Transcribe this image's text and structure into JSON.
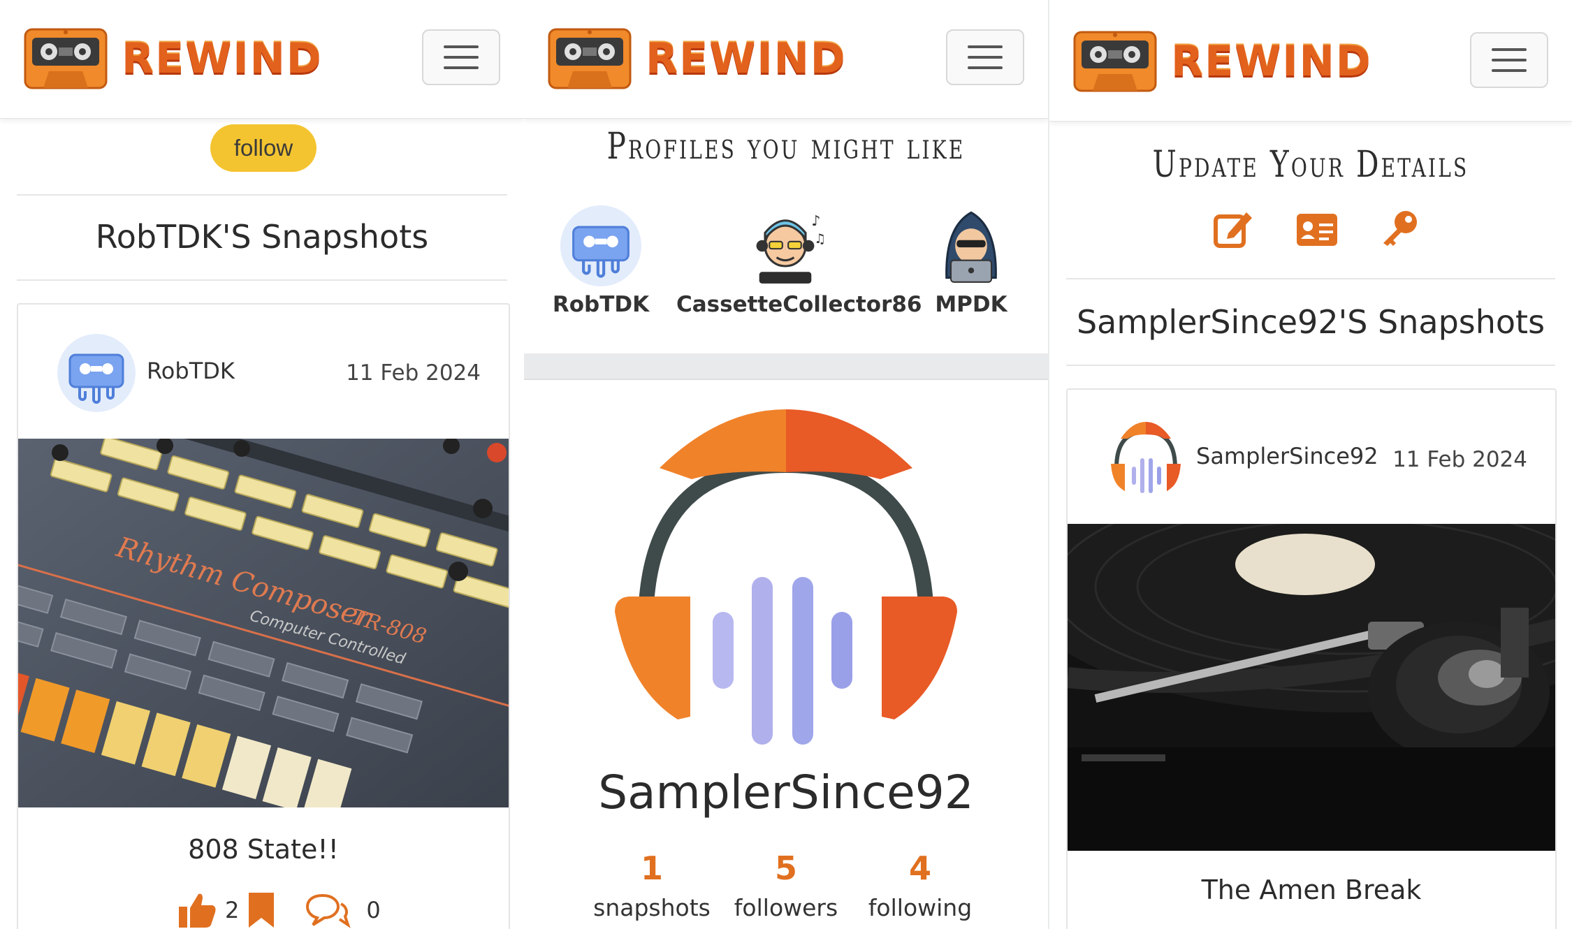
{
  "brand": {
    "name": "REWIND"
  },
  "panel1": {
    "follow_label": "follow",
    "section_title": "RobTDK'S Snapshots",
    "post": {
      "username": "RobTDK",
      "date": "11 Feb 2024",
      "title": "808 State!!",
      "likes": "2",
      "comments": "0"
    }
  },
  "panel2": {
    "profiles_title": "Profiles you might like",
    "profiles": [
      {
        "name": "RobTDK",
        "icon": "cassette-avatar-icon"
      },
      {
        "name": "CassetteCollector86",
        "icon": "dj-avatar-icon"
      },
      {
        "name": "MPDK",
        "icon": "hacker-avatar-icon"
      }
    ],
    "profile_name": "SamplerSince92",
    "stats": [
      {
        "value": "1",
        "label": "snapshots"
      },
      {
        "value": "5",
        "label": "followers"
      },
      {
        "value": "4",
        "label": "following"
      }
    ]
  },
  "panel3": {
    "update_title": "Update Your Details",
    "section_title": "SamplerSince92'S Snapshots",
    "post": {
      "username": "SamplerSince92",
      "date": "11 Feb 2024",
      "title": "The Amen Break"
    }
  },
  "colors": {
    "accent": "#e2611d",
    "follow": "#f4c430",
    "stat": "#e07020"
  }
}
